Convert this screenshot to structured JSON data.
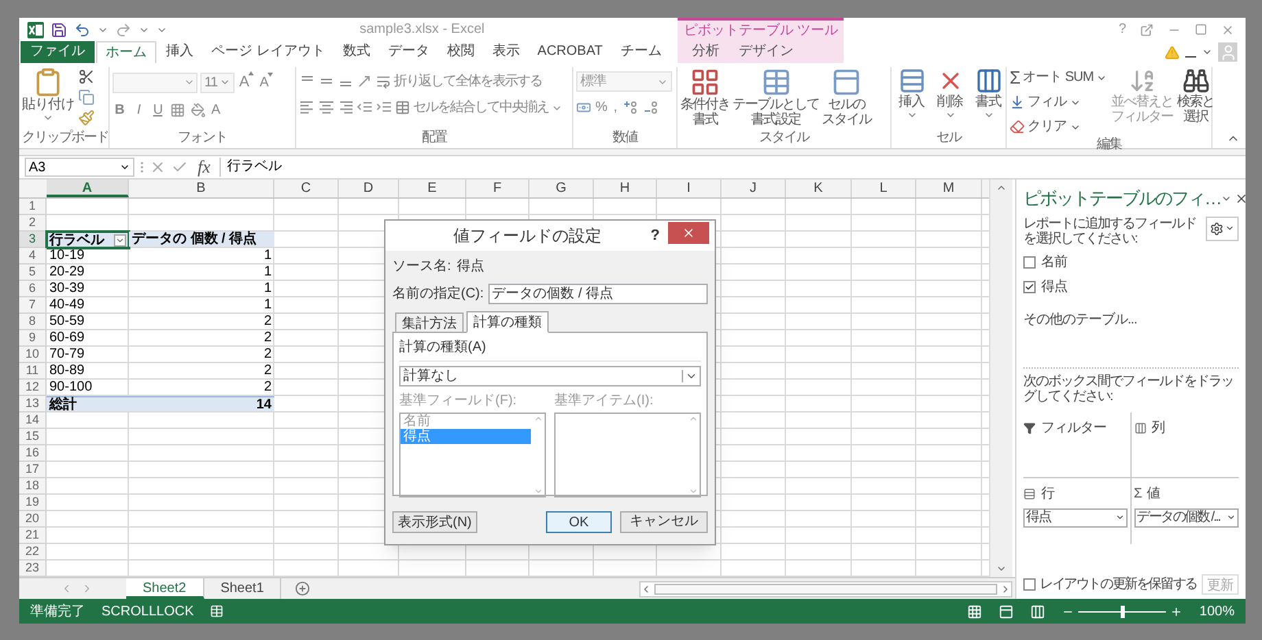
{
  "window": {
    "title": "sample3.xlsx - Excel",
    "context_group": "ピボットテーブル ツール",
    "help": "?"
  },
  "ribbon_tabs": [
    {
      "label": "ファイル",
      "kind": "file",
      "selected": false
    },
    {
      "label": "ホーム",
      "kind": "tab",
      "selected": true
    },
    {
      "label": "挿入",
      "kind": "tab",
      "selected": false
    },
    {
      "label": "ページ レイアウト",
      "kind": "tab",
      "selected": false
    },
    {
      "label": "数式",
      "kind": "tab",
      "selected": false
    },
    {
      "label": "データ",
      "kind": "tab",
      "selected": false
    },
    {
      "label": "校閲",
      "kind": "tab",
      "selected": false
    },
    {
      "label": "表示",
      "kind": "tab",
      "selected": false
    },
    {
      "label": "ACROBAT",
      "kind": "tab",
      "selected": false
    },
    {
      "label": "チーム",
      "kind": "tab",
      "selected": false
    },
    {
      "label": "分析",
      "kind": "context",
      "selected": false
    },
    {
      "label": "デザイン",
      "kind": "context",
      "selected": false
    }
  ],
  "ribbon": {
    "clipboard": {
      "label": "クリップボード",
      "paste": "貼り付け"
    },
    "font": {
      "label": "フォント",
      "size": "11",
      "grow": "A",
      "shrink": "A",
      "styles": [
        "B",
        "I",
        "U"
      ],
      "color_button": "A"
    },
    "alignment": {
      "label": "配置",
      "wrap": "折り返して全体を表示する",
      "merge": "セルを結合して中央揃え"
    },
    "number": {
      "label": "数値",
      "format": "標準",
      "percent": "%",
      "comma": ","
    },
    "styles": {
      "label": "スタイル",
      "buttons": [
        {
          "lines": [
            "条件付き",
            "書式"
          ]
        },
        {
          "lines": [
            "テーブルとして",
            "書式設定"
          ]
        },
        {
          "lines": [
            "セルの",
            "スタイル"
          ]
        }
      ]
    },
    "cells": {
      "label": "セル",
      "buttons": [
        "挿入",
        "削除",
        "書式"
      ]
    },
    "editing": {
      "label": "編集",
      "autosum_symbol": "Σ",
      "autosum": "オート SUM",
      "fill": "フィル",
      "clear": "クリア",
      "sort": [
        "並べ替えと",
        "フィルター"
      ],
      "find": [
        "検索と",
        "選択"
      ]
    }
  },
  "formula_bar": {
    "name_box": "A3",
    "fx": "fx",
    "formula": "行ラベル"
  },
  "sheet": {
    "columns": [
      {
        "label": "A",
        "selected": true
      },
      {
        "label": "B",
        "selected": false
      },
      {
        "label": "C",
        "selected": false
      },
      {
        "label": "D",
        "selected": false
      },
      {
        "label": "E",
        "selected": false
      },
      {
        "label": "F",
        "selected": false
      },
      {
        "label": "G",
        "selected": false
      },
      {
        "label": "H",
        "selected": false
      },
      {
        "label": "I",
        "selected": false
      },
      {
        "label": "J",
        "selected": false
      },
      {
        "label": "K",
        "selected": false
      },
      {
        "label": "L",
        "selected": false
      },
      {
        "label": "M",
        "selected": false
      }
    ],
    "rows": [
      {
        "label": "1",
        "selected": false
      },
      {
        "label": "2",
        "selected": false
      },
      {
        "label": "3",
        "selected": true
      },
      {
        "label": "4",
        "selected": false
      },
      {
        "label": "5",
        "selected": false
      },
      {
        "label": "6",
        "selected": false
      },
      {
        "label": "7",
        "selected": false
      },
      {
        "label": "8",
        "selected": false
      },
      {
        "label": "9",
        "selected": false
      },
      {
        "label": "10",
        "selected": false
      },
      {
        "label": "11",
        "selected": false
      },
      {
        "label": "12",
        "selected": false
      },
      {
        "label": "13",
        "selected": false
      },
      {
        "label": "14",
        "selected": false
      },
      {
        "label": "15",
        "selected": false
      },
      {
        "label": "16",
        "selected": false
      },
      {
        "label": "17",
        "selected": false
      },
      {
        "label": "18",
        "selected": false
      },
      {
        "label": "19",
        "selected": false
      },
      {
        "label": "20",
        "selected": false
      },
      {
        "label": "21",
        "selected": false
      },
      {
        "label": "22",
        "selected": false
      },
      {
        "label": "23",
        "selected": false
      }
    ],
    "pivot": {
      "header": [
        "行ラベル",
        "データの 個数 / 得点"
      ],
      "items": [
        {
          "label": "10-19",
          "value": "1"
        },
        {
          "label": "20-29",
          "value": "1"
        },
        {
          "label": "30-39",
          "value": "1"
        },
        {
          "label": "40-49",
          "value": "1"
        },
        {
          "label": "50-59",
          "value": "2"
        },
        {
          "label": "60-69",
          "value": "2"
        },
        {
          "label": "70-79",
          "value": "2"
        },
        {
          "label": "80-89",
          "value": "2"
        },
        {
          "label": "90-100",
          "value": "2"
        }
      ],
      "total": {
        "label": "総計",
        "value": "14"
      }
    }
  },
  "dialog": {
    "title": "値フィールドの設定",
    "help": "?",
    "source_label": "ソース名:",
    "source": "得点",
    "name_label": "名前の指定(C):",
    "name_value": "データの個数 / 得点",
    "tabs": [
      {
        "label": "集計方法",
        "selected": false
      },
      {
        "label": "計算の種類",
        "selected": true
      }
    ],
    "calc_label": "計算の種類(A)",
    "calc_value": "計算なし",
    "base_field": {
      "label": "基準フィールド(F):",
      "disabled": true,
      "items": [
        {
          "label": "名前",
          "selected": false
        },
        {
          "label": "得点",
          "selected": true
        }
      ]
    },
    "base_item": {
      "label": "基準アイテム(I):",
      "disabled": true
    },
    "number_format": "表示形式(N)",
    "ok": "OK",
    "cancel": "キャンセル"
  },
  "field_pane": {
    "title": "ピボットテーブルのフィ…",
    "instruction": "レポートに追加するフィールドを選択してください:",
    "fields": [
      {
        "label": "名前",
        "checked": false
      },
      {
        "label": "得点",
        "checked": true
      }
    ],
    "more_tables": "その他のテーブル...",
    "drag_hint": "次のボックス間でフィールドをドラッグしてください:",
    "areas": [
      {
        "kind": "filter",
        "label": "フィルター"
      },
      {
        "kind": "columns",
        "label": "列"
      },
      {
        "kind": "rows",
        "label": "行",
        "item": "得点"
      },
      {
        "kind": "values",
        "label": "値",
        "symbol": "Σ",
        "item": "データの個数 /..."
      }
    ],
    "defer": {
      "label": "レイアウトの更新を保留する",
      "checked": false
    },
    "update": {
      "label": "更新",
      "disabled": true
    }
  },
  "sheet_tabs": [
    {
      "label": "Sheet2",
      "selected": true
    },
    {
      "label": "Sheet1",
      "selected": false
    }
  ],
  "status_bar": {
    "ready": "準備完了",
    "scroll_lock": "SCROLLLOCK",
    "zoom": "100%",
    "zoom_slider": {
      "level": 0.5
    }
  }
}
